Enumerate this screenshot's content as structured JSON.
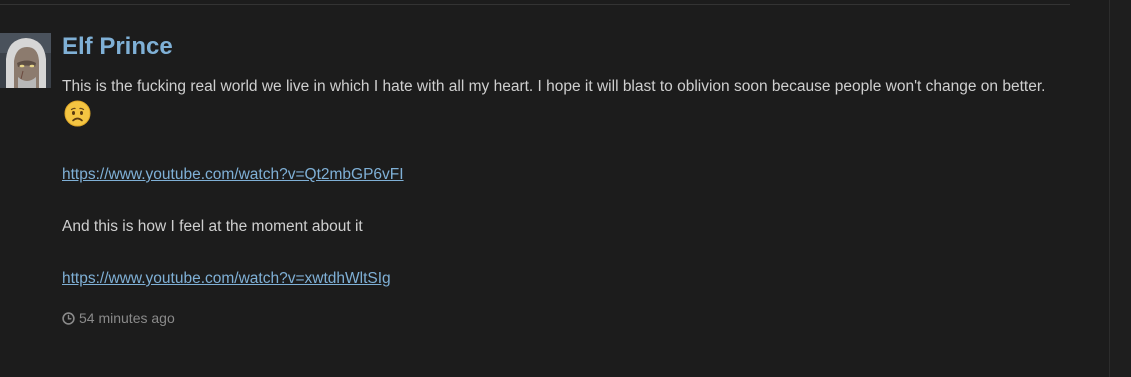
{
  "post": {
    "author": "Elf Prince",
    "avatar_icon": "witcher-avatar",
    "paragraph1": "This is the fucking real world we live in which I hate with all my heart. I hope it will blast to oblivion soon because people won't change on better.",
    "emoji_icon": "worried-face-emoji",
    "link1": "https://www.youtube.com/watch?v=Qt2mbGP6vFI",
    "paragraph2": "And this is how I feel at the moment about it",
    "link2": "https://www.youtube.com/watch?v=xwtdhWltSIg",
    "timestamp": "54 minutes ago",
    "timestamp_icon": "clock-icon"
  },
  "colors": {
    "background": "#1c1c1c",
    "username": "#7fb0d6",
    "link": "#7fb0d6",
    "text": "#cfcfcf",
    "muted": "#8a8a8a"
  }
}
